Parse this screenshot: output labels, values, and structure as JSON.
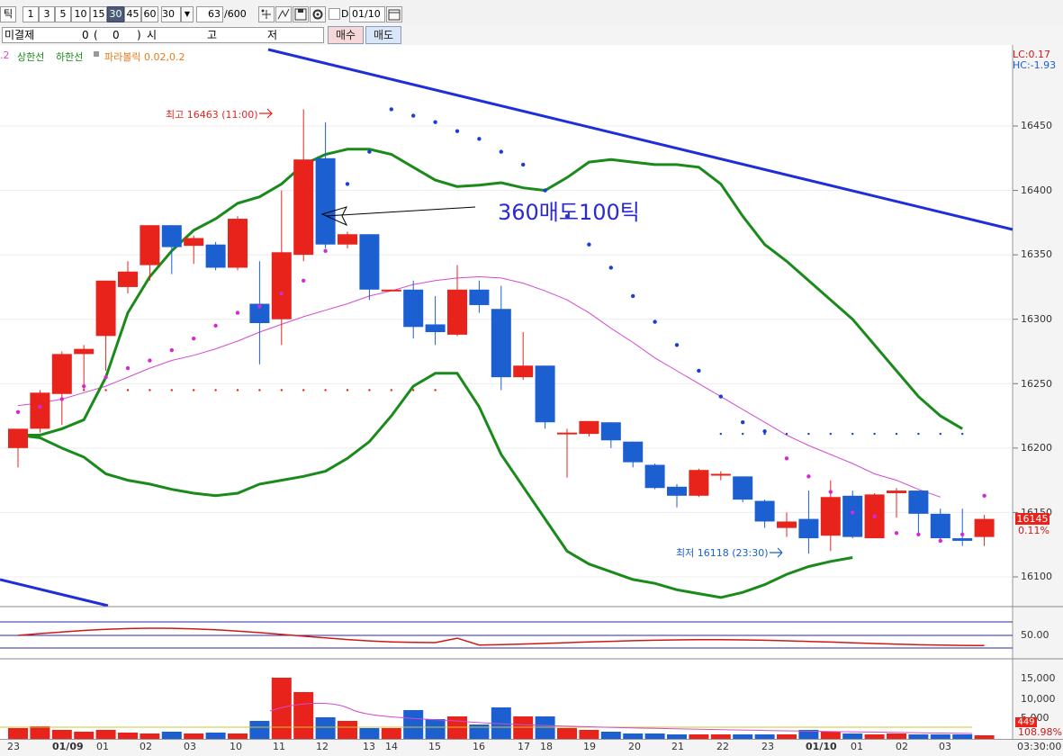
{
  "toolbar": {
    "tick_label": "틱",
    "intervals": [
      "1",
      "3",
      "5",
      "10",
      "15",
      "30",
      "45",
      "60"
    ],
    "selected_interval": "30",
    "custom_interval": "30",
    "count": "63",
    "count_max": "/600",
    "checkbox_label": "D",
    "date": "01/10"
  },
  "info": {
    "unsettled_label": "미결제",
    "unsettled_value": "0",
    "paren_open": "(",
    "paren_value": "0",
    "paren_close": ")",
    "si": "시",
    "go": "고",
    "jeo": "저",
    "buy_label": "매수",
    "sell_label": "매도"
  },
  "legend": {
    "prefix": ".2",
    "upper": "상한선",
    "lower": "하한선",
    "sar": "파라볼릭 0.02,0.2"
  },
  "corner": {
    "lc": "LC:0.17",
    "hc": "HC:-1.93"
  },
  "annotations": {
    "high": "최고 16463 (11:00)",
    "low": "최저 16118 (23:30)",
    "note": "360매도100틱"
  },
  "price_axis": [
    "16450",
    "16400",
    "16350",
    "16300",
    "16250",
    "16200",
    "16150",
    "16100"
  ],
  "current": {
    "price": "16145",
    "change": "0.11%"
  },
  "osc_axis": "50.00",
  "vol_axis": [
    "15,000",
    "10,000",
    "5,000"
  ],
  "vol_current": {
    "value": "449",
    "pct": "108.98%"
  },
  "x_labels": [
    "23",
    "01/09",
    "01",
    "02",
    "03",
    "10",
    "11",
    "12",
    "13",
    "14",
    "15",
    "16",
    "17",
    "18",
    "19",
    "20",
    "21",
    "22",
    "23",
    "01/10",
    "01",
    "02",
    "03"
  ],
  "time_now": "03:30:00",
  "colors": {
    "up": "#e8231b",
    "down": "#1b5fd1",
    "band": "#1a8a1a",
    "mid": "#d24bd2",
    "trend": "#1f2fd8"
  },
  "chart_data": {
    "type": "candlestick",
    "candles": [
      {
        "o": 16200,
        "h": 16215,
        "l": 16185,
        "c": 16215
      },
      {
        "o": 16215,
        "h": 16245,
        "l": 16212,
        "c": 16243
      },
      {
        "o": 16242,
        "h": 16275,
        "l": 16218,
        "c": 16273
      },
      {
        "o": 16273,
        "h": 16280,
        "l": 16245,
        "c": 16277
      },
      {
        "o": 16287,
        "h": 16330,
        "l": 16260,
        "c": 16330
      },
      {
        "o": 16325,
        "h": 16345,
        "l": 16320,
        "c": 16337
      },
      {
        "o": 16342,
        "h": 16373,
        "l": 16330,
        "c": 16373
      },
      {
        "o": 16373,
        "h": 16373,
        "l": 16335,
        "c": 16356
      },
      {
        "o": 16357,
        "h": 16365,
        "l": 16343,
        "c": 16363
      },
      {
        "o": 16358,
        "h": 16360,
        "l": 16338,
        "c": 16340
      },
      {
        "o": 16340,
        "h": 16380,
        "l": 16338,
        "c": 16378
      },
      {
        "o": 16312,
        "h": 16345,
        "l": 16265,
        "c": 16297
      },
      {
        "o": 16300,
        "h": 16400,
        "l": 16280,
        "c": 16352
      },
      {
        "o": 16350,
        "h": 16463,
        "l": 16345,
        "c": 16424
      },
      {
        "o": 16425,
        "h": 16453,
        "l": 16355,
        "c": 16358
      },
      {
        "o": 16358,
        "h": 16368,
        "l": 16355,
        "c": 16366
      },
      {
        "o": 16366,
        "h": 16366,
        "l": 16315,
        "c": 16323
      },
      {
        "o": 16323,
        "h": 16323,
        "l": 16322,
        "c": 16323
      },
      {
        "o": 16323,
        "h": 16330,
        "l": 16285,
        "c": 16294
      },
      {
        "o": 16296,
        "h": 16318,
        "l": 16280,
        "c": 16290
      },
      {
        "o": 16288,
        "h": 16342,
        "l": 16287,
        "c": 16323
      },
      {
        "o": 16323,
        "h": 16330,
        "l": 16305,
        "c": 16311
      },
      {
        "o": 16308,
        "h": 16326,
        "l": 16245,
        "c": 16255
      },
      {
        "o": 16255,
        "h": 16290,
        "l": 16253,
        "c": 16264
      },
      {
        "o": 16264,
        "h": 16264,
        "l": 16215,
        "c": 16220
      },
      {
        "o": 16212,
        "h": 16215,
        "l": 16177,
        "c": 16212
      },
      {
        "o": 16211,
        "h": 16220,
        "l": 16209,
        "c": 16221
      },
      {
        "o": 16220,
        "h": 16220,
        "l": 16200,
        "c": 16206
      },
      {
        "o": 16205,
        "h": 16205,
        "l": 16185,
        "c": 16189
      },
      {
        "o": 16187,
        "h": 16188,
        "l": 16168,
        "c": 16169
      },
      {
        "o": 16170,
        "h": 16172,
        "l": 16154,
        "c": 16163
      },
      {
        "o": 16163,
        "h": 16184,
        "l": 16162,
        "c": 16183
      },
      {
        "o": 16179,
        "h": 16182,
        "l": 16175,
        "c": 16180
      },
      {
        "o": 16178,
        "h": 16178,
        "l": 16158,
        "c": 16160
      },
      {
        "o": 16159,
        "h": 16160,
        "l": 16138,
        "c": 16143
      },
      {
        "o": 16138,
        "h": 16150,
        "l": 16131,
        "c": 16143
      },
      {
        "o": 16145,
        "h": 16167,
        "l": 16118,
        "c": 16130
      },
      {
        "o": 16132,
        "h": 16175,
        "l": 16120,
        "c": 16162
      },
      {
        "o": 16163,
        "h": 16167,
        "l": 16130,
        "c": 16131
      },
      {
        "o": 16130,
        "h": 16165,
        "l": 16130,
        "c": 16164
      },
      {
        "o": 16165,
        "h": 16169,
        "l": 16146,
        "c": 16167
      },
      {
        "o": 16167,
        "h": 16167,
        "l": 16134,
        "c": 16149
      },
      {
        "o": 16149,
        "h": 16153,
        "l": 16128,
        "c": 16130
      },
      {
        "o": 16130,
        "h": 16153,
        "l": 16124,
        "c": 16128
      },
      {
        "o": 16131,
        "h": 16148,
        "l": 16124,
        "c": 16145
      }
    ],
    "upper_band": [
      16210,
      16210,
      16215,
      16222,
      16255,
      16305,
      16333,
      16353,
      16369,
      16378,
      16390,
      16395,
      16405,
      16420,
      16428,
      16432,
      16432,
      16428,
      16418,
      16408,
      16403,
      16404,
      16406,
      16402,
      16400,
      16410,
      16422,
      16424,
      16422,
      16420,
      16420,
      16418,
      16405,
      16380,
      16358,
      16345,
      16330,
      16315,
      16300,
      16280,
      16260,
      16240,
      16225,
      16215
    ],
    "middle_band": [
      16233,
      16235,
      16238,
      16243,
      16248,
      16255,
      16262,
      16268,
      16272,
      16277,
      16283,
      16290,
      16296,
      16302,
      16307,
      16312,
      16318,
      16322,
      16327,
      16330,
      16332,
      16333,
      16332,
      16328,
      16322,
      16315,
      16305,
      16293,
      16282,
      16270,
      16260,
      16250,
      16240,
      16230,
      16220,
      16210,
      16202,
      16195,
      16188,
      16180,
      16175,
      16168,
      16162
    ],
    "lower_band": [
      16210,
      16208,
      16200,
      16193,
      16180,
      16175,
      16172,
      16168,
      16165,
      16163,
      16165,
      16172,
      16175,
      16178,
      16182,
      16192,
      16205,
      16225,
      16248,
      16258,
      16258,
      16232,
      16195,
      16170,
      16145,
      16120,
      16110,
      16104,
      16098,
      16095,
      16090,
      16087,
      16084,
      16088,
      16094,
      16102,
      16108,
      16112,
      16115
    ],
    "sar_dots_a": [
      16228,
      16232,
      16238,
      16248,
      16255,
      16262,
      16268,
      16276,
      16285,
      16295,
      16305,
      16310,
      16320,
      16330,
      16353,
      16405,
      16430,
      16463,
      16458,
      16453,
      16446,
      16440,
      16430,
      16420,
      16400,
      16380,
      16358,
      16340,
      16318,
      16298,
      16280,
      16260,
      16240,
      16220,
      16213,
      16192,
      16178,
      16166,
      16150,
      16147,
      16134,
      16133,
      16128,
      16133,
      16163
    ],
    "y_range": [
      16070,
      16500
    ]
  }
}
